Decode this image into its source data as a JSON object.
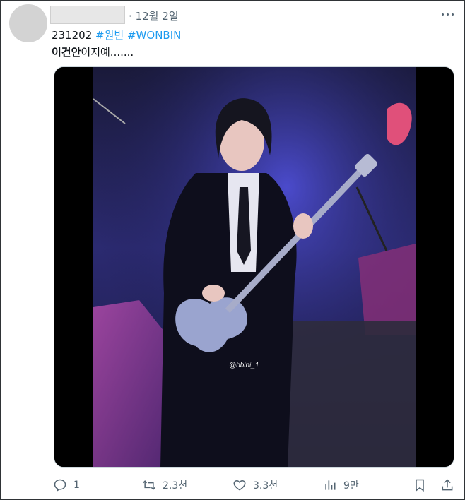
{
  "tweet": {
    "date": "· 12월 2일",
    "line1_plain": "231202 ",
    "hashtag1": "#원빈",
    "hashtag2": "#WONBIN",
    "line2_bold": "이건안",
    "line2_rest": "이지예......."
  },
  "media": {
    "watermark": "@bbini_1"
  },
  "actions": {
    "reply_count": "1",
    "retweet_count": "2.3천",
    "like_count": "3.3천",
    "view_count": "9만"
  },
  "icons": [
    "more-icon",
    "reply-icon",
    "retweet-icon",
    "like-icon",
    "views-icon",
    "bookmark-icon",
    "share-icon"
  ],
  "colors": {
    "hashtag": "#1d9bf0",
    "muted": "#536471",
    "text": "#0f1419"
  }
}
